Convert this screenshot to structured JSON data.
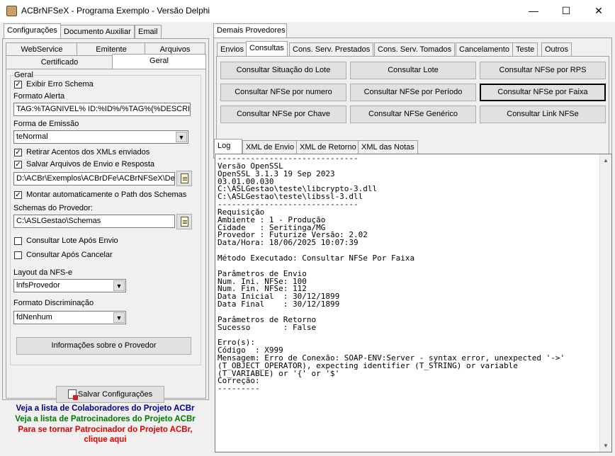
{
  "window": {
    "title": "ACBrNFSeX - Programa Exemplo - Versão Delphi",
    "minimize": "—",
    "maximize": "☐",
    "close": "✕"
  },
  "left": {
    "top_tabs": [
      "Configurações",
      "Documento Auxiliar",
      "Email"
    ],
    "sub_tabs_row1": [
      "WebService",
      "Emitente",
      "Arquivos"
    ],
    "sub_tabs_row2": [
      "Certificado",
      "Geral"
    ],
    "group_title": "Geral",
    "exibir_erro_schema": "Exibir Erro Schema",
    "formato_alerta_label": "Formato Alerta",
    "formato_alerta_value": "TAG:%TAGNIVEL% ID:%ID%/%TAG%(%DESCRI",
    "forma_emissao_label": "Forma de Emissão",
    "forma_emissao_value": "teNormal",
    "retirar_acentos": "Retirar Acentos dos XMLs enviados",
    "salvar_arquivos": "Salvar Arquivos de Envio e Resposta",
    "path_value": "D:\\ACBr\\Exemplos\\ACBrDFe\\ACBrNFSeX\\Delph",
    "montar_path": "Montar automaticamente o Path dos Schemas",
    "schemas_label": "Schemas do Provedor:",
    "schemas_value": "C:\\ASLGestao\\Schemas",
    "consultar_lote_apos_envio": "Consultar Lote Após Envio",
    "consultar_apos_cancelar": "Consultar Após Cancelar",
    "layout_label": "Layout da NFS-e",
    "layout_value": "lnfsProvedor",
    "formato_discriminacao_label": "Formato Discriminação",
    "formato_discriminacao_value": "fdNenhum",
    "info_provedor_button": "Informações sobre o Provedor",
    "salvar_button": "Salvar Configurações",
    "links": [
      {
        "text": "Veja a lista de Colaboradores do Projeto ACBr",
        "color": "#00008b"
      },
      {
        "text": "Veja a lista de Patrocinadores do Projeto ACBr",
        "color": "#007a00"
      },
      {
        "text": "Para se tornar Patrocinador do Projeto ACBr,",
        "color": "#e00000"
      },
      {
        "text": "clique aqui",
        "color": "#e00000"
      }
    ]
  },
  "right": {
    "top_tab": "Demais Provedores",
    "tabs": [
      "Envios",
      "Consultas",
      "Cons. Serv. Prestados",
      "Cons. Serv. Tomados",
      "Cancelamento",
      "Teste",
      "Outros"
    ],
    "buttons": [
      "Consultar Situação do Lote",
      "Consultar Lote",
      "Consultar NFSe por RPS",
      "Consultar NFSe por numero",
      "Consultar NFSe por Período",
      "Consultar NFSe por Faixa",
      "Consultar NFSe por Chave",
      "Consultar NFSe Genérico",
      "Consultar Link NFSe"
    ],
    "log_tabs": [
      "Log",
      "XML de Envio",
      "XML de Retorno",
      "XML das Notas"
    ],
    "log_text": "------------------------------\nVersão OpenSSL\nOpenSSL 3.1.3 19 Sep 2023\n03.01.00.030\nC:\\ASLGestao\\teste\\libcrypto-3.dll\nC:\\ASLGestao\\teste\\libssl-3.dll\n------------------------------\nRequisição\nAmbiente : 1 - Produção\nCidade   : Seritinga/MG\nProvedor : Futurize Versão: 2.02\nData/Hora: 18/06/2025 10:07:39\n\nMétodo Executado: Consultar NFSe Por Faixa\n\nParâmetros de Envio\nNum. Ini. NFSe: 100\nNum. Fin. NFSe: 112\nData Inicial  : 30/12/1899\nData Final    : 30/12/1899\n\nParâmetros de Retorno\nSucesso       : False\n\nErro(s):\nCódigo  : X999\nMensagem: Erro de Conexão: SOAP-ENV:Server - syntax error, unexpected '->'\n(T_OBJECT_OPERATOR), expecting identifier (T_STRING) or variable\n(T_VARIABLE) or '{' or '$'\nCorreção:\n---------"
  }
}
